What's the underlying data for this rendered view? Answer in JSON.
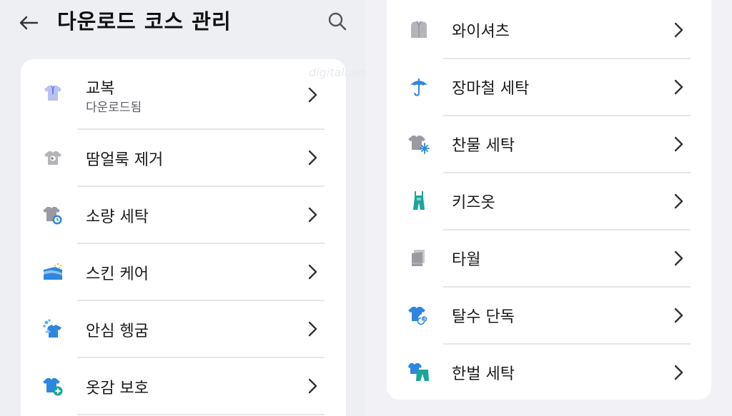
{
  "header": {
    "title": "다운로드 코스 관리",
    "back_icon": "arrow-left-icon",
    "search_icon": "search-icon"
  },
  "left_list": [
    {
      "label": "교복",
      "sub": "다운로드됨",
      "icon": "school-uniform-icon"
    },
    {
      "label": "땀얼룩 제거",
      "sub": "",
      "icon": "sweat-stain-icon"
    },
    {
      "label": "소량 세탁",
      "sub": "",
      "icon": "small-load-icon"
    },
    {
      "label": "스킨 케어",
      "sub": "",
      "icon": "skin-care-icon"
    },
    {
      "label": "안심 헹굼",
      "sub": "",
      "icon": "safe-rinse-icon"
    },
    {
      "label": "옷감 보호",
      "sub": "",
      "icon": "fabric-protect-icon"
    }
  ],
  "right_list": [
    {
      "label": "와이셔츠",
      "icon": "dress-shirt-icon"
    },
    {
      "label": "장마철 세탁",
      "icon": "umbrella-icon"
    },
    {
      "label": "찬물 세탁",
      "icon": "cold-water-icon"
    },
    {
      "label": "키즈옷",
      "icon": "kids-clothes-icon"
    },
    {
      "label": "타월",
      "icon": "towel-icon"
    },
    {
      "label": "탈수 단독",
      "icon": "spin-only-icon"
    },
    {
      "label": "한벌 세탁",
      "icon": "one-set-icon"
    }
  ],
  "watermark": "digitalcamp",
  "colors": {
    "page_bg": "#eeeff3",
    "card_bg": "#ffffff",
    "divider": "#e6e6ea",
    "accent_blue": "#2e86de",
    "accent_teal": "#1aa59a",
    "icon_gray": "#9a9aa0"
  }
}
